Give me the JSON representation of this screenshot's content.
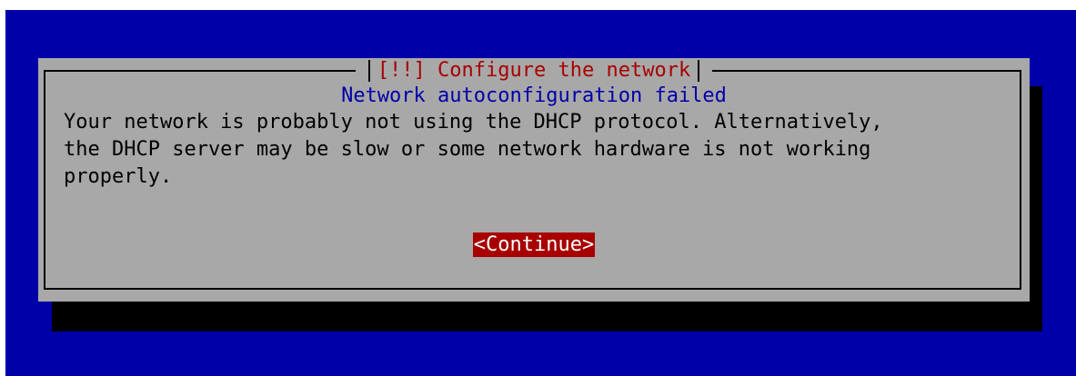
{
  "dialog": {
    "title": "[!!] Configure the network",
    "subtitle": "Network autoconfiguration failed",
    "body_lines": [
      "Your network is probably not using the DHCP protocol. Alternatively,",
      "the DHCP server may be slow or some network hardware is not working",
      "properly."
    ],
    "continue_label": "<Continue>"
  },
  "colors": {
    "background": "#0000a8",
    "dialog": "#a8a8a8",
    "title_text": "#a80000",
    "subtitle_text": "#0000a8",
    "button_bg": "#a80000",
    "button_text": "#ffffff"
  }
}
